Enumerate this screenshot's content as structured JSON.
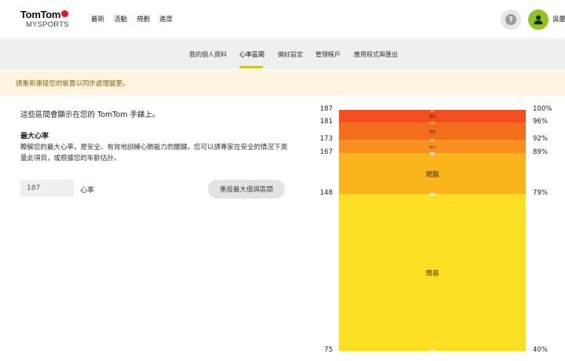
{
  "brand": {
    "name": "TomTom",
    "sub": "MYSPORTS"
  },
  "topnav": [
    "最新",
    "活動",
    "規劃",
    "進度"
  ],
  "user": {
    "name": "吳慶"
  },
  "subnav": {
    "items": [
      "我的個人資料",
      "心率區間",
      "偏好設定",
      "管理帳戶",
      "應用程式與匯出"
    ],
    "active": "心率區間"
  },
  "banner": "請重新連接您的裝置以同步處理變更。",
  "main": {
    "intro": "這些區間會顯示在您的 TomTom 手錶上。",
    "max_hr_title": "最大心率",
    "max_hr_desc": "瞭解您的最大心率，是安全、有效地訓練心肺能力的關鍵。您可以請專家在安全的情況下測量此項目，或根據您的年齡估計。",
    "max_hr_value": "187",
    "max_hr_unit": "心率",
    "reset_label": "重設最大值與區間"
  },
  "chart_data": {
    "type": "bar",
    "zones": [
      {
        "name": "衝刺",
        "from_bpm": 181,
        "to_bpm": 187,
        "color": "#f24e1f",
        "tiny": true
      },
      {
        "name": "速度",
        "from_bpm": 173,
        "to_bpm": 181,
        "color": "#f46d1c",
        "tiny": true
      },
      {
        "name": "耐力",
        "from_bpm": 167,
        "to_bpm": 173,
        "color": "#f7901e",
        "tiny": true
      },
      {
        "name": "燃脂",
        "from_bpm": 148,
        "to_bpm": 167,
        "color": "#fbb51c",
        "tiny": false
      },
      {
        "name": "簡易",
        "from_bpm": 75,
        "to_bpm": 148,
        "color": "#fde023",
        "tiny": false
      }
    ],
    "bpm_ticks": [
      "187",
      "181",
      "173",
      "167",
      "148",
      "75"
    ],
    "pct_ticks": [
      "100%",
      "96%",
      "92%",
      "89%",
      "79%",
      "40%"
    ],
    "ymin": 75,
    "ymax": 187
  }
}
